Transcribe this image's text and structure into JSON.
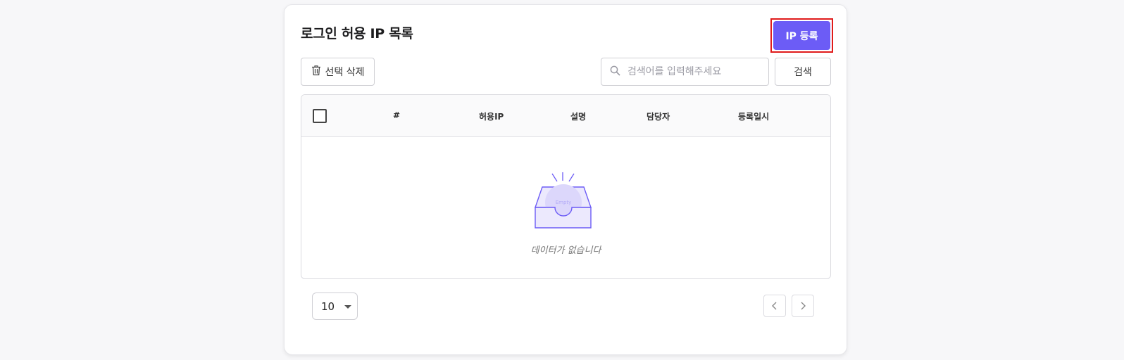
{
  "header": {
    "title": "로그인 허용 IP 목록",
    "register_label": "IP 등록"
  },
  "toolbar": {
    "delete_label": "선택 삭제",
    "search_placeholder": "검색어를 입력해주세요",
    "search_label": "검색"
  },
  "table": {
    "columns": [
      "#",
      "허용IP",
      "설명",
      "담당자",
      "등록일시"
    ],
    "empty_badge": "Empty",
    "empty_text": "데이터가 없습니다"
  },
  "pagination": {
    "page_size": "10"
  },
  "colors": {
    "accent": "#6c5cf6",
    "highlight_border": "#e01b1b"
  },
  "icons": [
    "trash-icon",
    "search-icon",
    "chevron-down-icon",
    "chevron-left-icon",
    "chevron-right-icon",
    "empty-inbox-icon"
  ]
}
